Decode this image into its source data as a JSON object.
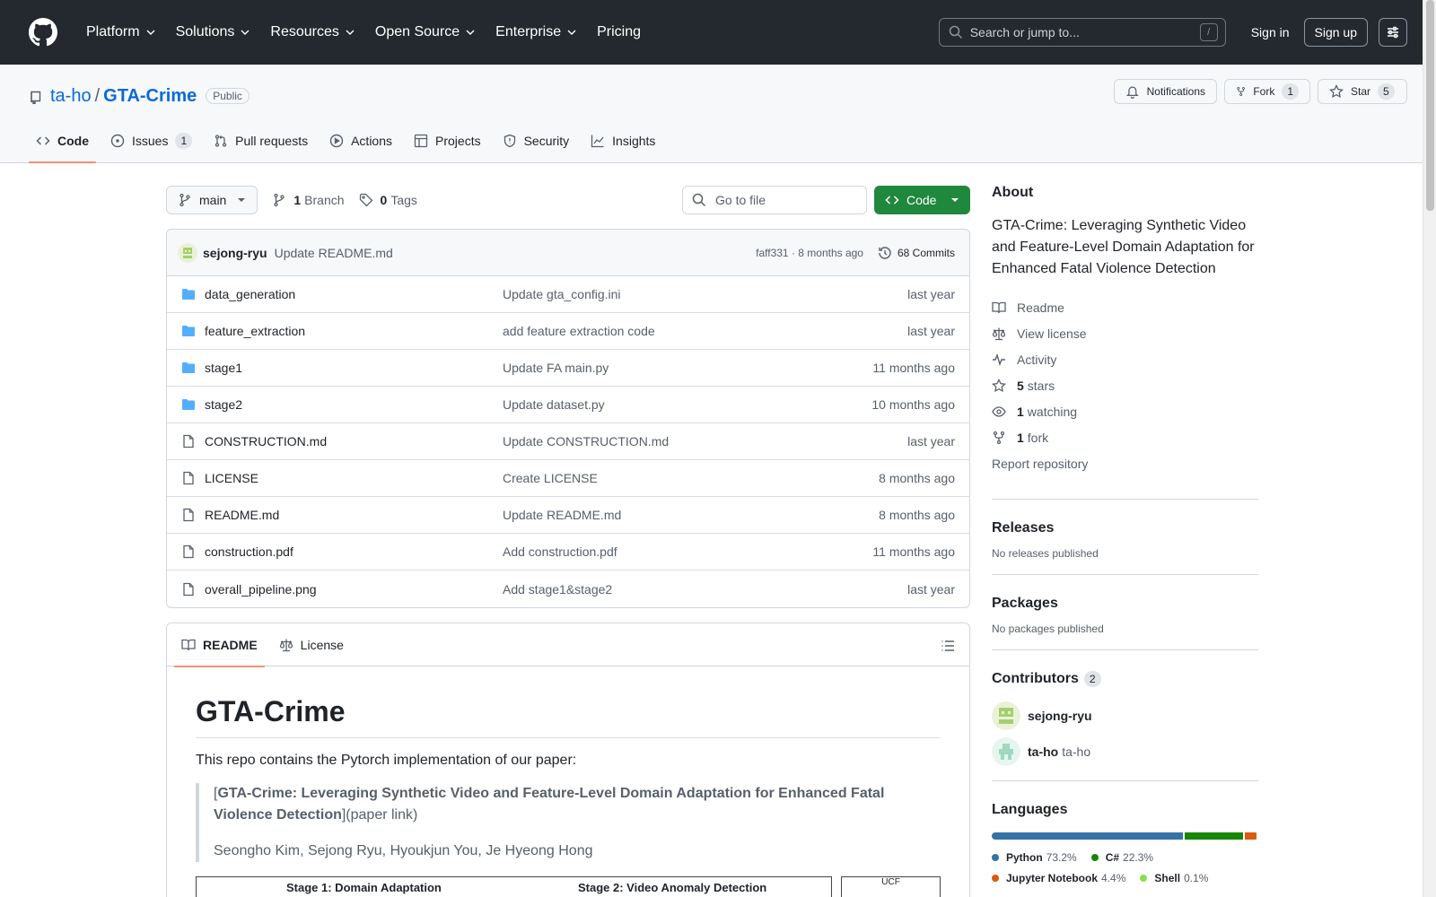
{
  "header": {
    "nav": [
      "Platform",
      "Solutions",
      "Resources",
      "Open Source",
      "Enterprise",
      "Pricing"
    ],
    "search_placeholder": "Search or jump to...",
    "slash": "/",
    "signin": "Sign in",
    "signup": "Sign up"
  },
  "repo": {
    "owner": "ta-ho",
    "separator": "/",
    "name": "GTA-Crime",
    "visibility": "Public",
    "notifications_label": "Notifications",
    "fork_label": "Fork",
    "fork_count": "1",
    "star_label": "Star",
    "star_count": "5",
    "tabs": [
      {
        "label": "Code",
        "icon": "code-icon"
      },
      {
        "label": "Issues",
        "count": "1",
        "icon": "issue-icon"
      },
      {
        "label": "Pull requests",
        "icon": "pull-request-icon"
      },
      {
        "label": "Actions",
        "icon": "play-icon"
      },
      {
        "label": "Projects",
        "icon": "table-icon"
      },
      {
        "label": "Security",
        "icon": "shield-icon"
      },
      {
        "label": "Insights",
        "icon": "graph-icon"
      }
    ]
  },
  "toolbar": {
    "branch": "main",
    "branch_count": "1",
    "branch_label": "Branch",
    "tag_count": "0",
    "tag_label": "Tags",
    "goto_placeholder": "Go to file",
    "code_label": "Code"
  },
  "commit": {
    "author": "sejong-ryu",
    "message": "Update README.md",
    "meta": "faff331 · 8 months ago",
    "count_label": "68 Commits"
  },
  "files": [
    {
      "name": "data_generation",
      "type": "dir",
      "message": "Update gta_config.ini",
      "date": "last year"
    },
    {
      "name": "feature_extraction",
      "type": "dir",
      "message": "add feature extraction code",
      "date": "last year"
    },
    {
      "name": "stage1",
      "type": "dir",
      "message": "Update FA main.py",
      "date": "11 months ago"
    },
    {
      "name": "stage2",
      "type": "dir",
      "message": "Update dataset.py",
      "date": "10 months ago"
    },
    {
      "name": "CONSTRUCTION.md",
      "type": "file",
      "message": "Update CONSTRUCTION.md",
      "date": "last year"
    },
    {
      "name": "LICENSE",
      "type": "file",
      "message": "Create LICENSE",
      "date": "8 months ago"
    },
    {
      "name": "README.md",
      "type": "file",
      "message": "Update README.md",
      "date": "8 months ago"
    },
    {
      "name": "construction.pdf",
      "type": "file",
      "message": "Add construction.pdf",
      "date": "11 months ago"
    },
    {
      "name": "overall_pipeline.png",
      "type": "file",
      "message": "Add stage1&stage2",
      "date": "last year"
    }
  ],
  "readme": {
    "tab_readme": "README",
    "tab_license": "License",
    "title": "GTA-Crime",
    "intro": "This repo contains the Pytorch implementation of our paper:",
    "paper_open": "[",
    "paper_title": "GTA-Crime: Leveraging Synthetic Video and Feature-Level Domain Adaptation for Enhanced Fatal Violence Detection",
    "paper_link": "](paper link)",
    "authors": "Seongho Kim, Sejong Ryu, Hyoukjun You, Je Hyeong Hong",
    "img_text_a": "Stage 1: Domain Adaptation",
    "img_text_b": "Stage 2: Video Anomaly Detection",
    "img_text_c": "UCF"
  },
  "about": {
    "heading": "About",
    "description": "GTA-Crime: Leveraging Synthetic Video and Feature-Level Domain Adaptation for Enhanced Fatal Violence Detection",
    "readme": "Readme",
    "license": "View license",
    "activity": "Activity",
    "stars_num": "5",
    "stars_label": "stars",
    "watching_num": "1",
    "watching_label": "watching",
    "forks_num": "1",
    "forks_label": "fork",
    "report": "Report repository"
  },
  "releases": {
    "heading": "Releases",
    "text": "No releases published"
  },
  "packages": {
    "heading": "Packages",
    "text": "No packages published"
  },
  "contributors": {
    "heading": "Contributors",
    "count": "2",
    "list": [
      {
        "name": "sejong-ryu",
        "login": ""
      },
      {
        "name": "ta-ho",
        "login": "ta-ho"
      }
    ]
  },
  "languages": {
    "heading": "Languages",
    "list": [
      {
        "name": "Python",
        "percent": "73.2%",
        "value": 73.2,
        "color": "#3572A5"
      },
      {
        "name": "C#",
        "percent": "22.3%",
        "value": 22.3,
        "color": "#178600"
      },
      {
        "name": "Jupyter Notebook",
        "percent": "4.4%",
        "value": 4.4,
        "color": "#DA5B0B"
      },
      {
        "name": "Shell",
        "percent": "0.1%",
        "value": 0.1,
        "color": "#89e051"
      }
    ]
  }
}
